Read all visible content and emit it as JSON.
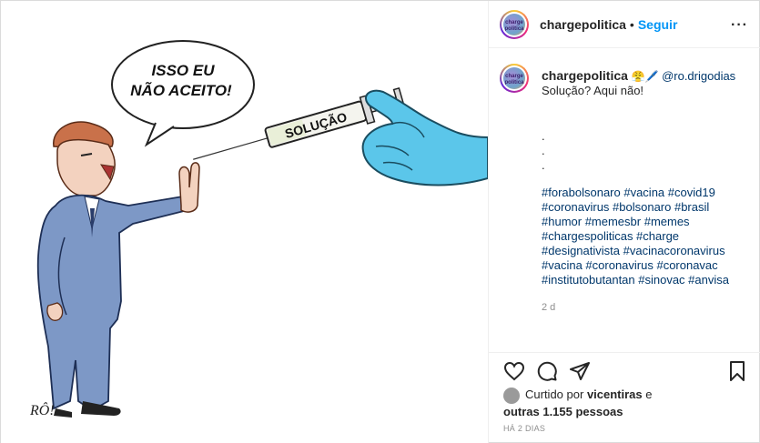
{
  "post": {
    "author": "chargepolitica",
    "follow_label": "Seguir",
    "separator": "•",
    "more_label": "···",
    "avatar_text": "charge politica"
  },
  "caption": {
    "author": "chargepolitica",
    "emoji": "😤🖊️",
    "mention": "@ro.drigodias",
    "text": "Solução? Aqui não!",
    "dots": [
      ".",
      ".",
      "."
    ],
    "hashtags": "#forabolsonaro #vacina #covid19 #coronavirus #bolsonaro #brasil #humor #memesbr #memes #chargespoliticas #charge #designativista #vacinacoronavirus #vacina #coronavirus #coronavac #institutobutantan #sinovac #anvisa",
    "age": "2 d"
  },
  "likes": {
    "prefix": "Curtido por",
    "user": "vicentiras",
    "joiner": "e",
    "others": "outras 1.155 pessoas"
  },
  "timestamp": "HÁ 2 DIAS",
  "cartoon": {
    "speech_line1": "ISSO EU",
    "speech_line2": "NÃO ACEITO!",
    "syringe_label": "SOLUÇÃO",
    "signature": "RÔ!"
  },
  "colors": {
    "accent": "#0095f6",
    "hashtag": "#00376b",
    "glove": "#5bc6ea",
    "suit": "#7d98c6",
    "hair": "#c9714a"
  },
  "icons": [
    "heart-icon",
    "comment-icon",
    "share-icon",
    "bookmark-icon",
    "more-icon"
  ]
}
